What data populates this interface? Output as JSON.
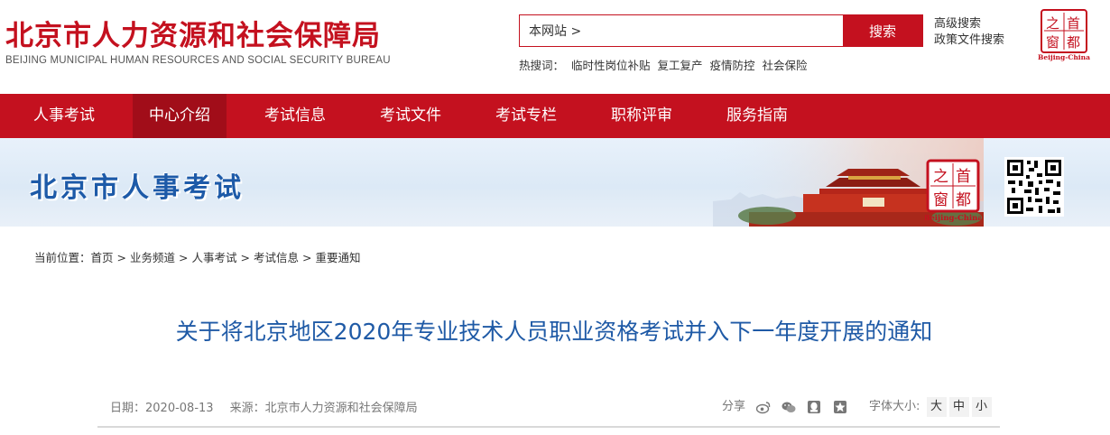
{
  "header": {
    "title": "北京市人力资源和社会保障局",
    "subtitle": "BEIJING MUNICIPAL HUMAN RESOURCES AND SOCIAL SECURITY BUREAU",
    "search_value": "本网站 >",
    "search_button": "搜索",
    "advanced_search": "高级搜索",
    "policy_search": "政策文件搜索",
    "hot_label": "热搜词：",
    "hot_words": [
      "临时性岗位补贴",
      "复工复产",
      "疫情防控",
      "社会保险"
    ],
    "seal": {
      "chars": [
        "之",
        "首",
        "窗",
        "都"
      ],
      "caption": "Beijing-China"
    }
  },
  "nav": {
    "items": [
      "人事考试",
      "中心介绍",
      "考试信息",
      "考试文件",
      "考试专栏",
      "职称评审",
      "服务指南"
    ],
    "active_index": 1
  },
  "banner": {
    "title": "北京市人事考试",
    "seal": {
      "chars": [
        "之",
        "首",
        "窗",
        "都"
      ],
      "caption": "Beijing-China"
    }
  },
  "breadcrumb": {
    "label": "当前位置：",
    "items": [
      "首页",
      "业务频道",
      "人事考试",
      "考试信息",
      "重要通知"
    ]
  },
  "article": {
    "title": "关于将北京地区2020年专业技术人员职业资格考试并入下一年度开展的通知",
    "date": "日期：2020-08-13",
    "source": "来源：北京市人力资源和社会保障局",
    "share_label": "分享",
    "fontsize_label": "字体大小:",
    "fontsize_options": [
      "大",
      "中",
      "小"
    ]
  },
  "colors": {
    "brand_red": "#c4111f",
    "title_blue": "#1f5aa6"
  }
}
